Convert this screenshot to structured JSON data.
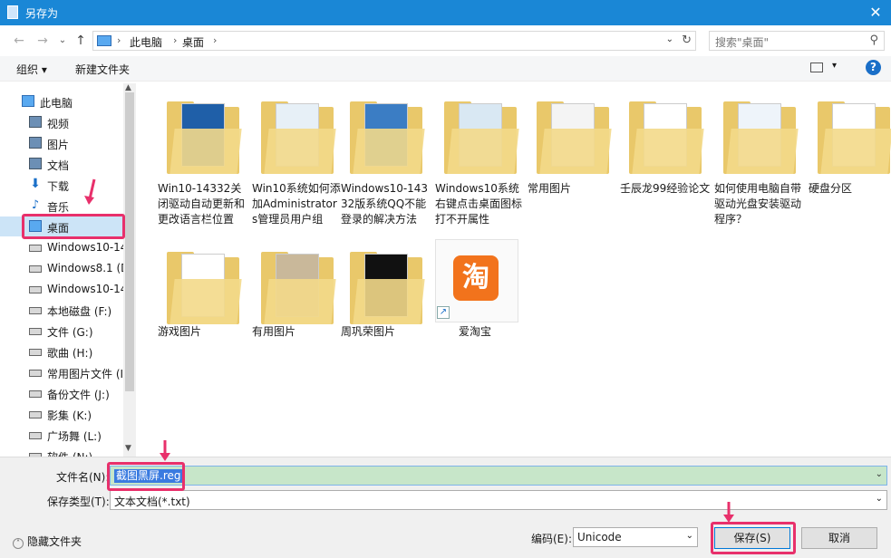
{
  "window": {
    "title": "另存为",
    "close_glyph": "✕"
  },
  "nav": {
    "back_icon": "←",
    "forward_icon": "→",
    "recent_icon": "⌄",
    "up_icon": "↑",
    "crumbs": [
      "此电脑",
      "桌面"
    ],
    "crumb_sep": "›",
    "search_placeholder": "搜索\"桌面\""
  },
  "toolbar": {
    "organize": "组织 ▾",
    "new_folder": "新建文件夹",
    "help": "?"
  },
  "sidebar": {
    "items": [
      {
        "label": "此电脑",
        "icon": "pc-icon",
        "top": true
      },
      {
        "label": "视频",
        "icon": "video-folder-icon"
      },
      {
        "label": "图片",
        "icon": "pictures-folder-icon"
      },
      {
        "label": "文档",
        "icon": "documents-folder-icon"
      },
      {
        "label": "下载",
        "icon": "download-icon"
      },
      {
        "label": "音乐",
        "icon": "music-icon"
      },
      {
        "label": "桌面",
        "icon": "desktop-icon",
        "selected": true
      },
      {
        "label": "Windows10-14",
        "icon": "drive-icon"
      },
      {
        "label": "Windows8.1 (D",
        "icon": "drive-icon"
      },
      {
        "label": "Windows10-14",
        "icon": "drive-icon"
      },
      {
        "label": "本地磁盘 (F:)",
        "icon": "drive-icon"
      },
      {
        "label": "文件 (G:)",
        "icon": "drive-icon"
      },
      {
        "label": "歌曲 (H:)",
        "icon": "drive-icon"
      },
      {
        "label": "常用图片文件 (I:",
        "icon": "drive-icon"
      },
      {
        "label": "备份文件 (J:)",
        "icon": "drive-icon"
      },
      {
        "label": "影集 (K:)",
        "icon": "drive-icon"
      },
      {
        "label": "广场舞 (L:)",
        "icon": "drive-icon"
      },
      {
        "label": "软件 (N:)",
        "icon": "drive-icon"
      }
    ]
  },
  "files": [
    {
      "name": "Win10-14332关闭驱动自动更新和更改语言栏位置",
      "type": "folder"
    },
    {
      "name": "Win10系统如何添加Administrators管理员用户组",
      "type": "folder"
    },
    {
      "name": "Windows10-14332版系统QQ不能登录的解决方法",
      "type": "folder"
    },
    {
      "name": "Windows10系统右键点击桌面图标打不开属性",
      "type": "folder"
    },
    {
      "name": "常用图片",
      "type": "folder"
    },
    {
      "name": "壬辰龙99经验论文",
      "type": "folder"
    },
    {
      "name": "如何使用电脑自带驱动光盘安装驱动程序？",
      "type": "folder"
    },
    {
      "name": "硬盘分区",
      "type": "folder"
    },
    {
      "name": "游戏图片",
      "type": "folder"
    },
    {
      "name": "有用图片",
      "type": "folder"
    },
    {
      "name": "周巩荣图片",
      "type": "folder"
    },
    {
      "name": "爱淘宝",
      "type": "shortcut",
      "logo": "淘"
    }
  ],
  "bottom": {
    "filename_label": "文件名(N):",
    "filename_value": "截图黑屏.reg",
    "filetype_label": "保存类型(T):",
    "filetype_value": "文本文档(*.txt)",
    "hide_folders": "隐藏文件夹",
    "encoding_label": "编码(E):",
    "encoding_value": "Unicode",
    "save_button": "保存(S)",
    "cancel_button": "取消"
  },
  "colors": {
    "titlebar": "#1a87d6",
    "selected": "#cce4f7",
    "highlight": "#e8306b"
  }
}
